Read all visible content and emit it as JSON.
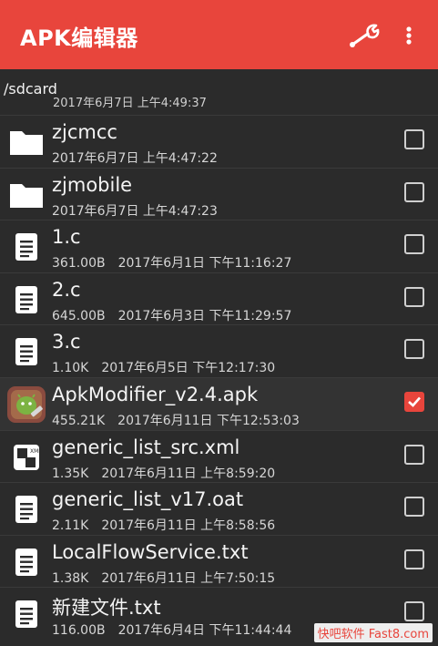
{
  "appbar": {
    "title": "APK编辑器",
    "bg": "#e8453c"
  },
  "path": "/sdcard",
  "partial_row": "2017年6月7日 上午4:49:37",
  "rows": [
    {
      "name": "zjcmcc",
      "size": "",
      "date": "2017年6月7日 上午4:47:22",
      "type": "folder-icon",
      "checked": false
    },
    {
      "name": "zjmobile",
      "size": "",
      "date": "2017年6月7日 上午4:47:23",
      "type": "folder-icon",
      "checked": false
    },
    {
      "name": "1.c",
      "size": "361.00B",
      "date": "2017年6月1日 下午11:16:27",
      "type": "document-icon",
      "checked": false
    },
    {
      "name": "2.c",
      "size": "645.00B",
      "date": "2017年6月3日 下午11:29:57",
      "type": "document-icon",
      "checked": false
    },
    {
      "name": "3.c",
      "size": "1.10K",
      "date": "2017年6月5日 下午12:17:30",
      "type": "document-icon",
      "checked": false
    },
    {
      "name": "ApkModifier_v2.4.apk",
      "size": "455.21K",
      "date": "2017年6月11日 下午12:53:03",
      "type": "android-app-icon",
      "checked": true
    },
    {
      "name": "generic_list_src.xml",
      "size": "1.35K",
      "date": "2017年6月11日 上午8:59:20",
      "type": "xml-file-icon",
      "checked": false
    },
    {
      "name": "generic_list_v17.oat",
      "size": "2.11K",
      "date": "2017年6月11日 上午8:58:56",
      "type": "document-icon",
      "checked": false
    },
    {
      "name": "LocalFlowService.txt",
      "size": "1.38K",
      "date": "2017年6月11日 上午7:50:15",
      "type": "document-icon",
      "checked": false
    },
    {
      "name": "新建文件.txt",
      "size": "116.00B",
      "date": "2017年6月4日 下午11:44:44",
      "type": "document-icon",
      "checked": false
    }
  ],
  "watermark": "快吧软件 Fast8.com"
}
